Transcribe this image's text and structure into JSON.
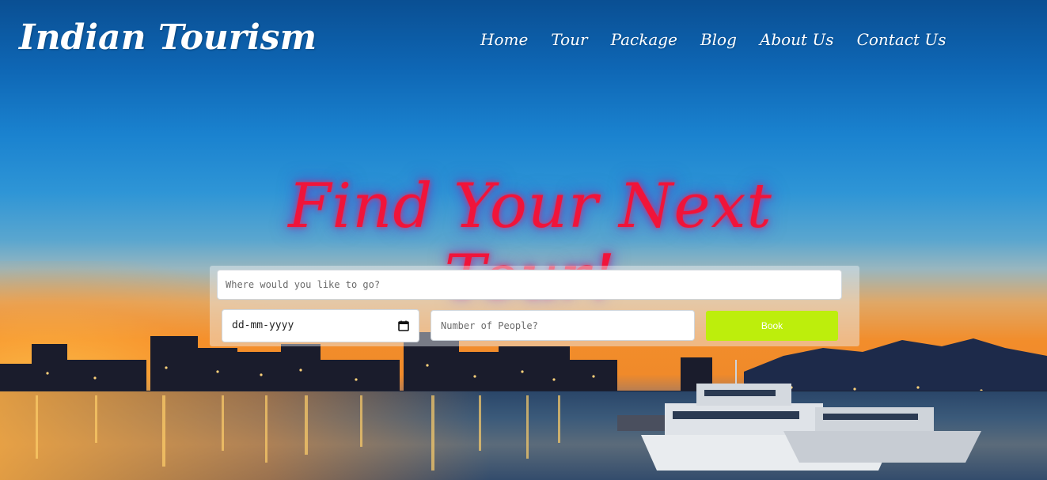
{
  "brand": {
    "title": "Indian Tourism"
  },
  "nav": {
    "items": [
      "Home",
      "Tour",
      "Package",
      "Blog",
      "About Us",
      "Contact Us"
    ]
  },
  "hero": {
    "headline": "Find Your Next Tour!"
  },
  "booking": {
    "destination_placeholder": "Where would you like to go?",
    "date_value": "dd-mm-yyyy",
    "people_placeholder": "Number of People?",
    "book_label": "Book"
  },
  "colors": {
    "headline": "#f0143a",
    "book_button": "#bdee0c",
    "nav_text": "#ffffff"
  },
  "icons": [
    "calendar-icon"
  ]
}
